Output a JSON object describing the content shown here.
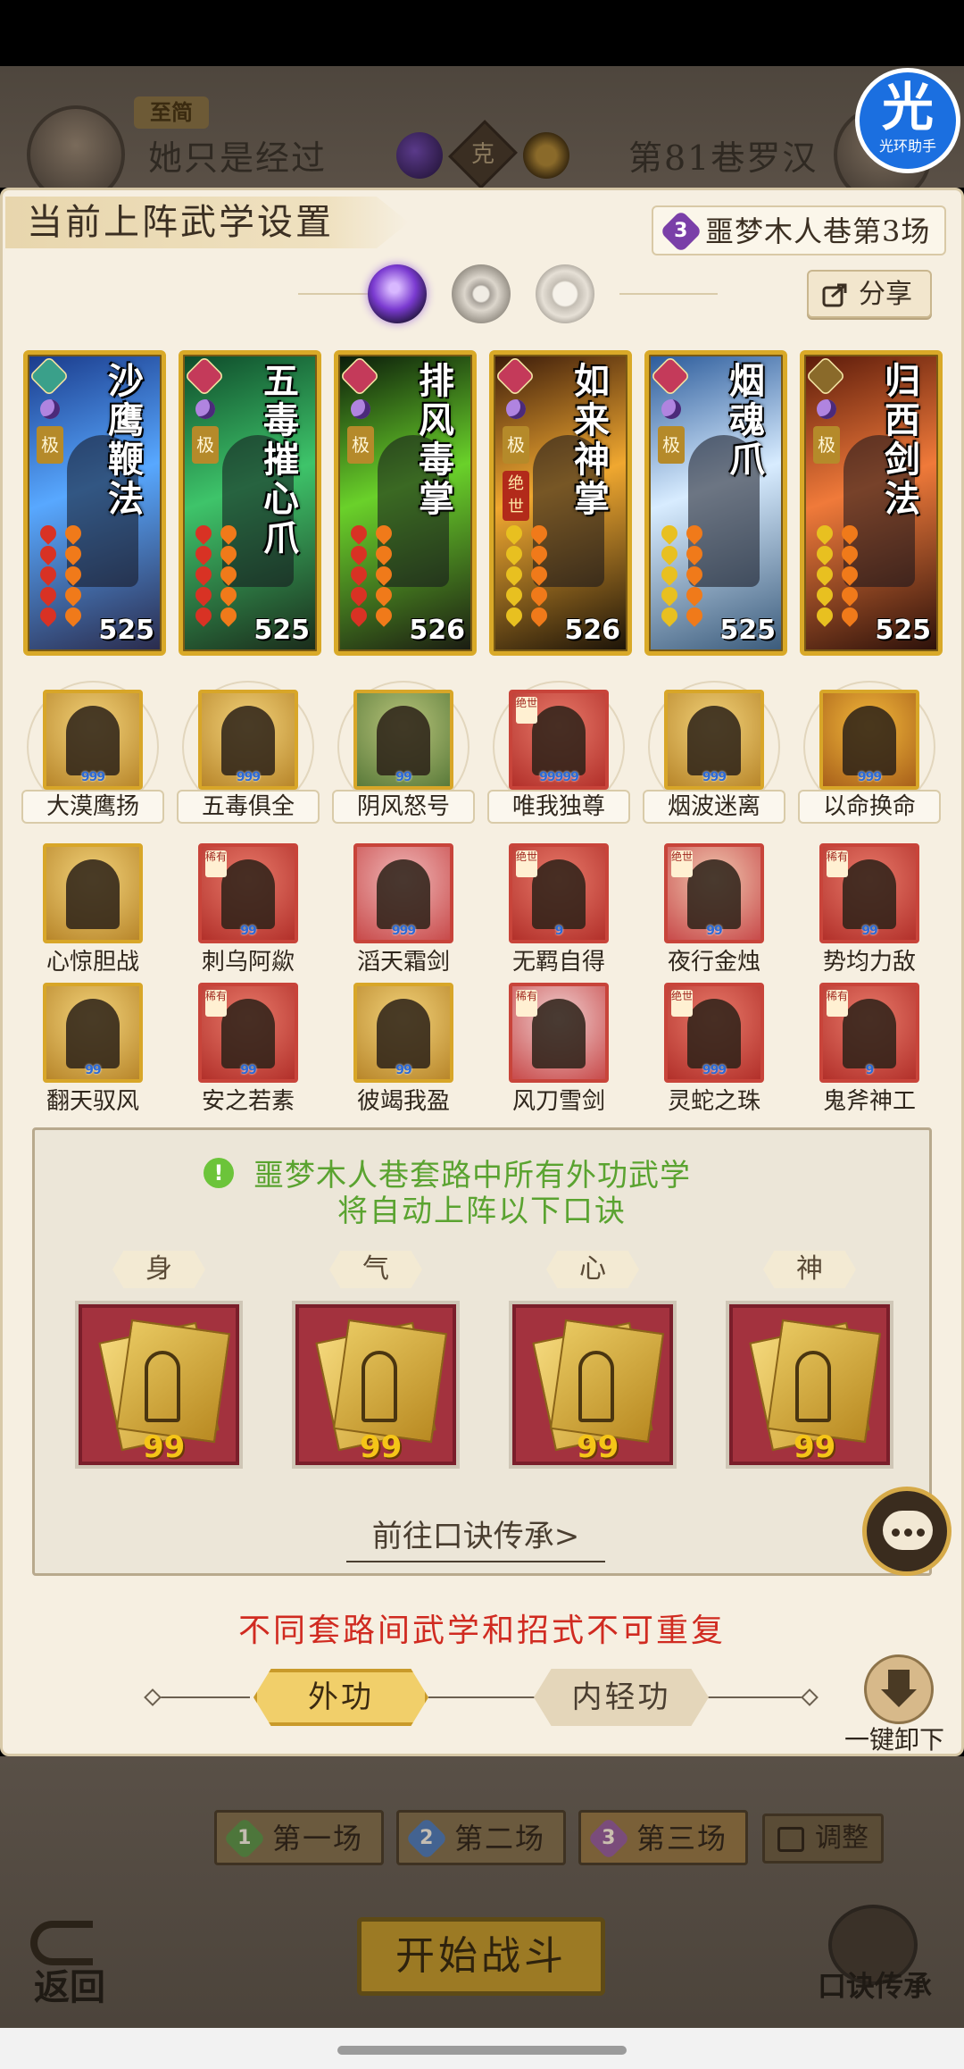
{
  "header": {
    "player_tag": "至简",
    "player_name": "她只是经过",
    "vs_label": "克",
    "opponent_name": "第81巷罗汉",
    "helper_glyph": "光",
    "helper_label": "光环助手"
  },
  "panel": {
    "title": "当前上阵武学设置",
    "stage_number": "3",
    "stage_title": "噩梦木人巷第3场",
    "share_label": "分享"
  },
  "skills": [
    {
      "name": "沙鹰鞭法",
      "tier": "极",
      "juexi": "",
      "power": "525",
      "bg": [
        "#1a3a8a",
        "#58a8ff",
        "#2a2a4a"
      ],
      "emblem": "#3aa08a",
      "pip": "#d83224"
    },
    {
      "name": "五毒摧心爪",
      "tier": "极",
      "juexi": "",
      "power": "525",
      "bg": [
        "#0e4a2a",
        "#3ec46a",
        "#1a2a1a"
      ],
      "emblem": "#c43a5a",
      "pip": "#d83224"
    },
    {
      "name": "排风毒掌",
      "tier": "极",
      "juexi": "",
      "power": "526",
      "bg": [
        "#0a1a0a",
        "#6ad12a",
        "#1a1a12"
      ],
      "emblem": "#c43a5a",
      "pip": "#d83224"
    },
    {
      "name": "如来神掌",
      "tier": "极",
      "juexi": "绝世",
      "power": "526",
      "bg": [
        "#3a1a0a",
        "#f0a830",
        "#1a1208"
      ],
      "emblem": "#c43a5a",
      "pip": "#e8c020"
    },
    {
      "name": "烟魂爪",
      "tier": "极",
      "juexi": "",
      "power": "525",
      "bg": [
        "#2a5a9a",
        "#d8ecff",
        "#3a5a7a"
      ],
      "emblem": "#c43a5a",
      "pip": "#e8c020"
    },
    {
      "name": "归西剑法",
      "tier": "极",
      "juexi": "",
      "power": "525",
      "bg": [
        "#5a1a0a",
        "#f07a3a",
        "#2a100a"
      ],
      "emblem": "#8a6a2a",
      "pip": "#e8c020"
    }
  ],
  "core_moves": [
    {
      "label": "大漠鹰扬",
      "lvl": "999",
      "bg": [
        "#f2d27a",
        "#b8862a"
      ],
      "red": false,
      "tag": ""
    },
    {
      "label": "五毒俱全",
      "lvl": "999",
      "bg": [
        "#f2d27a",
        "#b8862a"
      ],
      "red": false,
      "tag": ""
    },
    {
      "label": "阴风怒号",
      "lvl": "99",
      "bg": [
        "#b8c47a",
        "#5a7a3a"
      ],
      "red": false,
      "tag": ""
    },
    {
      "label": "唯我独尊",
      "lvl": "99999",
      "bg": [
        "#e87a6a",
        "#b2302a"
      ],
      "red": true,
      "tag": "绝世"
    },
    {
      "label": "烟波迷离",
      "lvl": "999",
      "bg": [
        "#f2d27a",
        "#b8862a"
      ],
      "red": false,
      "tag": ""
    },
    {
      "label": "以命换命",
      "lvl": "999",
      "bg": [
        "#f2b83a",
        "#a8601a"
      ],
      "red": false,
      "tag": ""
    }
  ],
  "moves_row2": [
    {
      "label": "心惊胆战",
      "lvl": "",
      "bg": [
        "#f2d27a",
        "#b8862a"
      ],
      "red": false,
      "tag": ""
    },
    {
      "label": "刺乌阿歘",
      "lvl": "99",
      "bg": [
        "#e87a6a",
        "#b2302a"
      ],
      "red": true,
      "tag": "稀有"
    },
    {
      "label": "滔天霜剑",
      "lvl": "999",
      "bg": [
        "#f0b8b8",
        "#c84a4a"
      ],
      "red": true,
      "tag": ""
    },
    {
      "label": "无羁自得",
      "lvl": "9",
      "bg": [
        "#e87a6a",
        "#b2302a"
      ],
      "red": true,
      "tag": "绝世"
    },
    {
      "label": "夜行金烛",
      "lvl": "99",
      "bg": [
        "#f0c8b0",
        "#c84a4a"
      ],
      "red": true,
      "tag": "绝世"
    },
    {
      "label": "势均力敌",
      "lvl": "99",
      "bg": [
        "#e87a6a",
        "#b2302a"
      ],
      "red": true,
      "tag": "稀有"
    }
  ],
  "moves_row3": [
    {
      "label": "翻天驭风",
      "lvl": "99",
      "bg": [
        "#f2d27a",
        "#b8862a"
      ],
      "red": false,
      "tag": ""
    },
    {
      "label": "安之若素",
      "lvl": "99",
      "bg": [
        "#e87a6a",
        "#b2302a"
      ],
      "red": true,
      "tag": "稀有"
    },
    {
      "label": "彼竭我盈",
      "lvl": "99",
      "bg": [
        "#f2d27a",
        "#b8862a"
      ],
      "red": false,
      "tag": ""
    },
    {
      "label": "风刀雪剑",
      "lvl": "",
      "bg": [
        "#f0d0d0",
        "#c84a4a"
      ],
      "red": true,
      "tag": "稀有"
    },
    {
      "label": "灵蛇之珠",
      "lvl": "999",
      "bg": [
        "#e87a6a",
        "#b2302a"
      ],
      "red": true,
      "tag": "绝世"
    },
    {
      "label": "鬼斧神工",
      "lvl": "9",
      "bg": [
        "#e87a6a",
        "#b2302a"
      ],
      "red": true,
      "tag": "稀有"
    }
  ],
  "formula": {
    "notice_line1": "噩梦木人巷套路中所有外功武学",
    "notice_line2": "将自动上阵以下口诀",
    "slots": [
      {
        "label": "身",
        "level": "99"
      },
      {
        "label": "气",
        "level": "99"
      },
      {
        "label": "心",
        "level": "99"
      },
      {
        "label": "神",
        "level": "99"
      }
    ],
    "goto_link": "前往口诀传承>"
  },
  "warning": "不同套路间武学和招式不可重复",
  "tabs": {
    "active": "外功",
    "inactive": "内轻功"
  },
  "unload_label": "一键卸下",
  "rounds": [
    {
      "number": "1",
      "label": "第一场",
      "color": "#3a8a3a"
    },
    {
      "number": "2",
      "label": "第二场",
      "color": "#2a6ac8"
    },
    {
      "number": "3",
      "label": "第三场",
      "color": "#7a3fa8"
    }
  ],
  "adjust_label": "调整",
  "back_label": "返回",
  "start_label": "开始战斗",
  "inherit_label": "口诀传承",
  "colors": {
    "panel_bg": "#f6efe1",
    "gold_border": "#d9a928",
    "warning_red": "#d02a20",
    "notice_green": "#5aa330"
  }
}
